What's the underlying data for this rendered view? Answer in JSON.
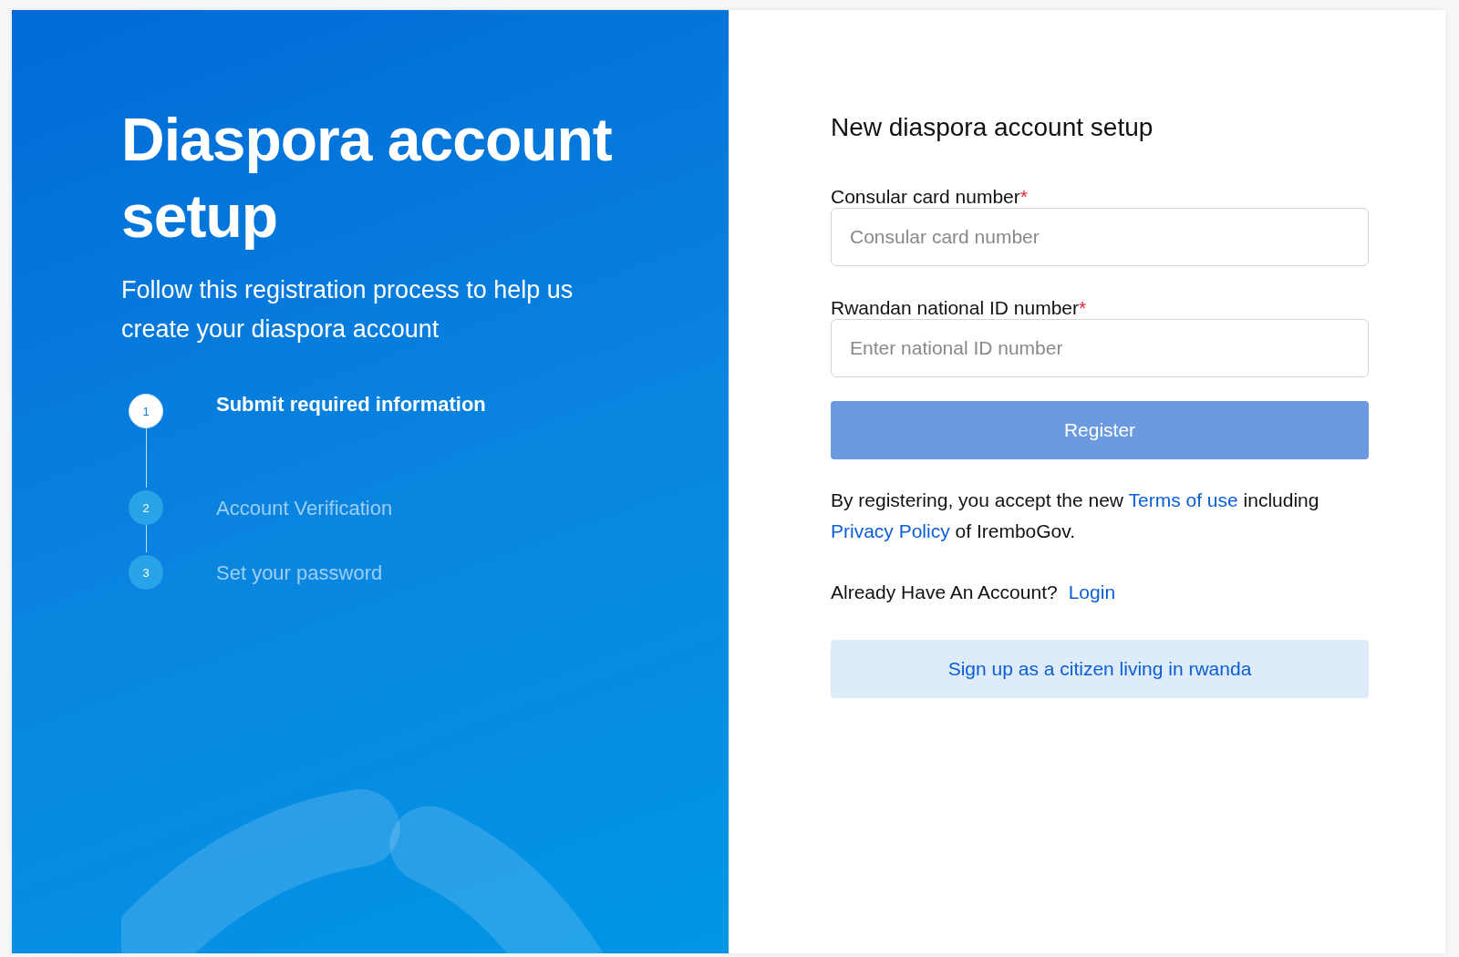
{
  "intro": {
    "title": "Diaspora account setup",
    "subtitle": "Follow this registration process to help us create your diaspora account"
  },
  "steps": [
    {
      "number": "1",
      "label": "Submit required information",
      "active": true
    },
    {
      "number": "2",
      "label": "Account Verification",
      "active": false
    },
    {
      "number": "3",
      "label": "Set your password",
      "active": false
    }
  ],
  "form": {
    "heading": "New diaspora account setup",
    "fields": [
      {
        "label": "Consular card number",
        "required_mark": "*",
        "placeholder": "Consular card number"
      },
      {
        "label": "Rwandan national ID number",
        "required_mark": "*",
        "placeholder": "Enter national ID number"
      }
    ],
    "submit": {
      "label": "Register",
      "disabled": true
    },
    "terms": [
      {
        "kind": "text",
        "text": "By registering, you accept the new"
      },
      {
        "kind": "link",
        "text": "Terms of use"
      },
      {
        "kind": "text",
        "text": "including"
      },
      {
        "kind": "link",
        "text": "Privacy Policy"
      },
      {
        "kind": "text",
        "text": "of IremboGov."
      }
    ],
    "login_prompt": "Already Have An Account?",
    "login_link": "Login",
    "alt_signup": "Sign up as a citizen living in rwanda"
  }
}
